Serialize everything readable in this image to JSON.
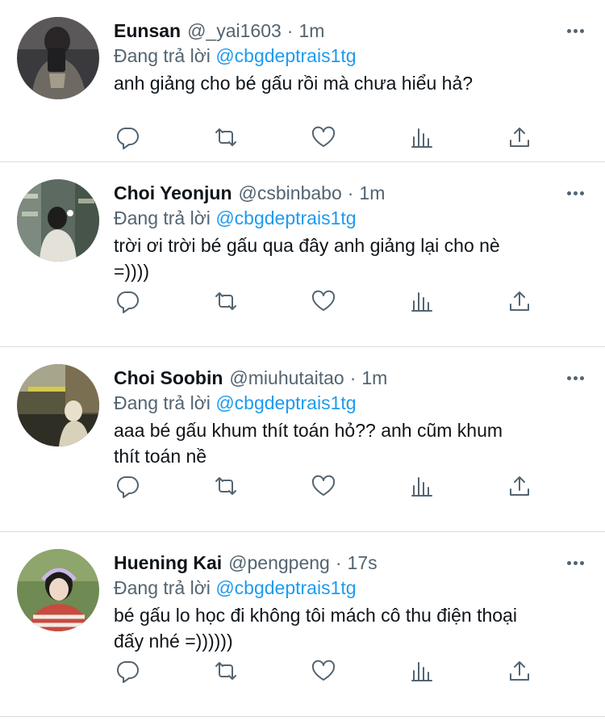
{
  "replies": [
    {
      "name": "Eunsan",
      "handle": "@_yai1603",
      "separator": "·",
      "time": "1m",
      "replying_prefix": "Đang trả lời",
      "replying_to": "@cbgdeptrais1tg",
      "text": "anh giảng cho bé gấu rồi mà chưa hiểu hả?",
      "avatar_colors": [
        "#2b2b2e",
        "#8c8577"
      ]
    },
    {
      "name": "Choi Yeonjun",
      "handle": "@csbinbabo",
      "separator": "·",
      "time": "1m",
      "replying_prefix": "Đang trả lời",
      "replying_to": "@cbgdeptrais1tg",
      "text": "trời ơi trời bé gấu qua đây anh giảng lại cho nè\n=))))",
      "avatar_colors": [
        "#6f7c72",
        "#d8d6cf"
      ]
    },
    {
      "name": "Choi Soobin",
      "handle": "@miuhutaitao",
      "separator": "·",
      "time": "1m",
      "replying_prefix": "Đang trả lời",
      "replying_to": "@cbgdeptrais1tg",
      "text": "aaa bé gấu khum thít toán hỏ?? anh cũm khum\nthít toán nề",
      "avatar_colors": [
        "#4a4634",
        "#cfc7a8"
      ]
    },
    {
      "name": "Huening Kai",
      "handle": "@pengpeng",
      "separator": "·",
      "time": "17s",
      "replying_prefix": "Đang trả lời",
      "replying_to": "@cbgdeptrais1tg",
      "text": "bé gấu lo học đi không tôi mách cô thu điện thoại\nđấy nhé =))))))",
      "avatar_colors": [
        "#5d7a45",
        "#c9433f"
      ]
    }
  ],
  "icons": [
    "reply-icon",
    "retweet-icon",
    "like-icon",
    "analytics-icon",
    "share-icon",
    "more-icon"
  ],
  "colors": {
    "name": "#0f1419",
    "secondary": "#536471",
    "mention": "#1d9bf0",
    "divider": "#d7dbdf"
  }
}
